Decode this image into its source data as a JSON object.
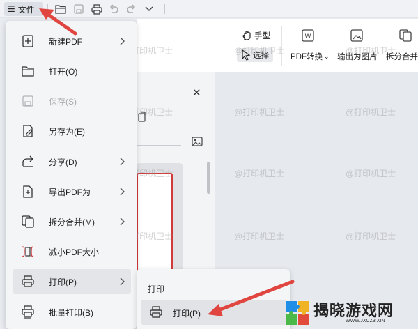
{
  "topbar": {
    "file_label": "文件",
    "icons": [
      "menu-icon",
      "open-folder-icon",
      "save-icon",
      "print-icon",
      "undo-icon",
      "redo-icon",
      "dropdown-icon"
    ]
  },
  "ribbon": {
    "hand_tool": "手型",
    "select_tool": "选择",
    "pdf_convert": "PDF转换",
    "export_image": "输出为图片",
    "split_merge": "拆分合并"
  },
  "menu": {
    "items": [
      {
        "label": "新建PDF",
        "icon": "new-pdf-icon",
        "has_submenu": true,
        "disabled": false
      },
      {
        "label": "打开(O)",
        "icon": "folder-icon",
        "has_submenu": false,
        "disabled": false
      },
      {
        "label": "保存(S)",
        "icon": "save-icon",
        "has_submenu": false,
        "disabled": true
      },
      {
        "label": "另存为(E)",
        "icon": "save-as-icon",
        "has_submenu": false,
        "disabled": false
      },
      {
        "label": "分享(D)",
        "icon": "share-icon",
        "has_submenu": true,
        "disabled": false
      },
      {
        "label": "导出PDF为",
        "icon": "export-icon",
        "has_submenu": true,
        "disabled": false
      },
      {
        "label": "拆分合并(M)",
        "icon": "split-merge-icon",
        "has_submenu": true,
        "disabled": false
      },
      {
        "label": "减小PDF大小",
        "icon": "compress-icon",
        "has_submenu": false,
        "disabled": false
      },
      {
        "label": "打印(P)",
        "icon": "print-icon",
        "has_submenu": true,
        "disabled": false,
        "active": true
      },
      {
        "label": "批量打印(B)",
        "icon": "batch-print-icon",
        "has_submenu": false,
        "disabled": false
      }
    ]
  },
  "submenu": {
    "title": "打印",
    "item_label": "打印(P)"
  },
  "watermark": "@打印机卫士",
  "logo": {
    "main": "揭晓游戏网",
    "sub": "WWW.JXCZ3.XIN"
  },
  "colors": {
    "accent_red": "#e0453f",
    "thumb_border": "#d23a3a",
    "menu_bg": "#f4f5f7"
  }
}
